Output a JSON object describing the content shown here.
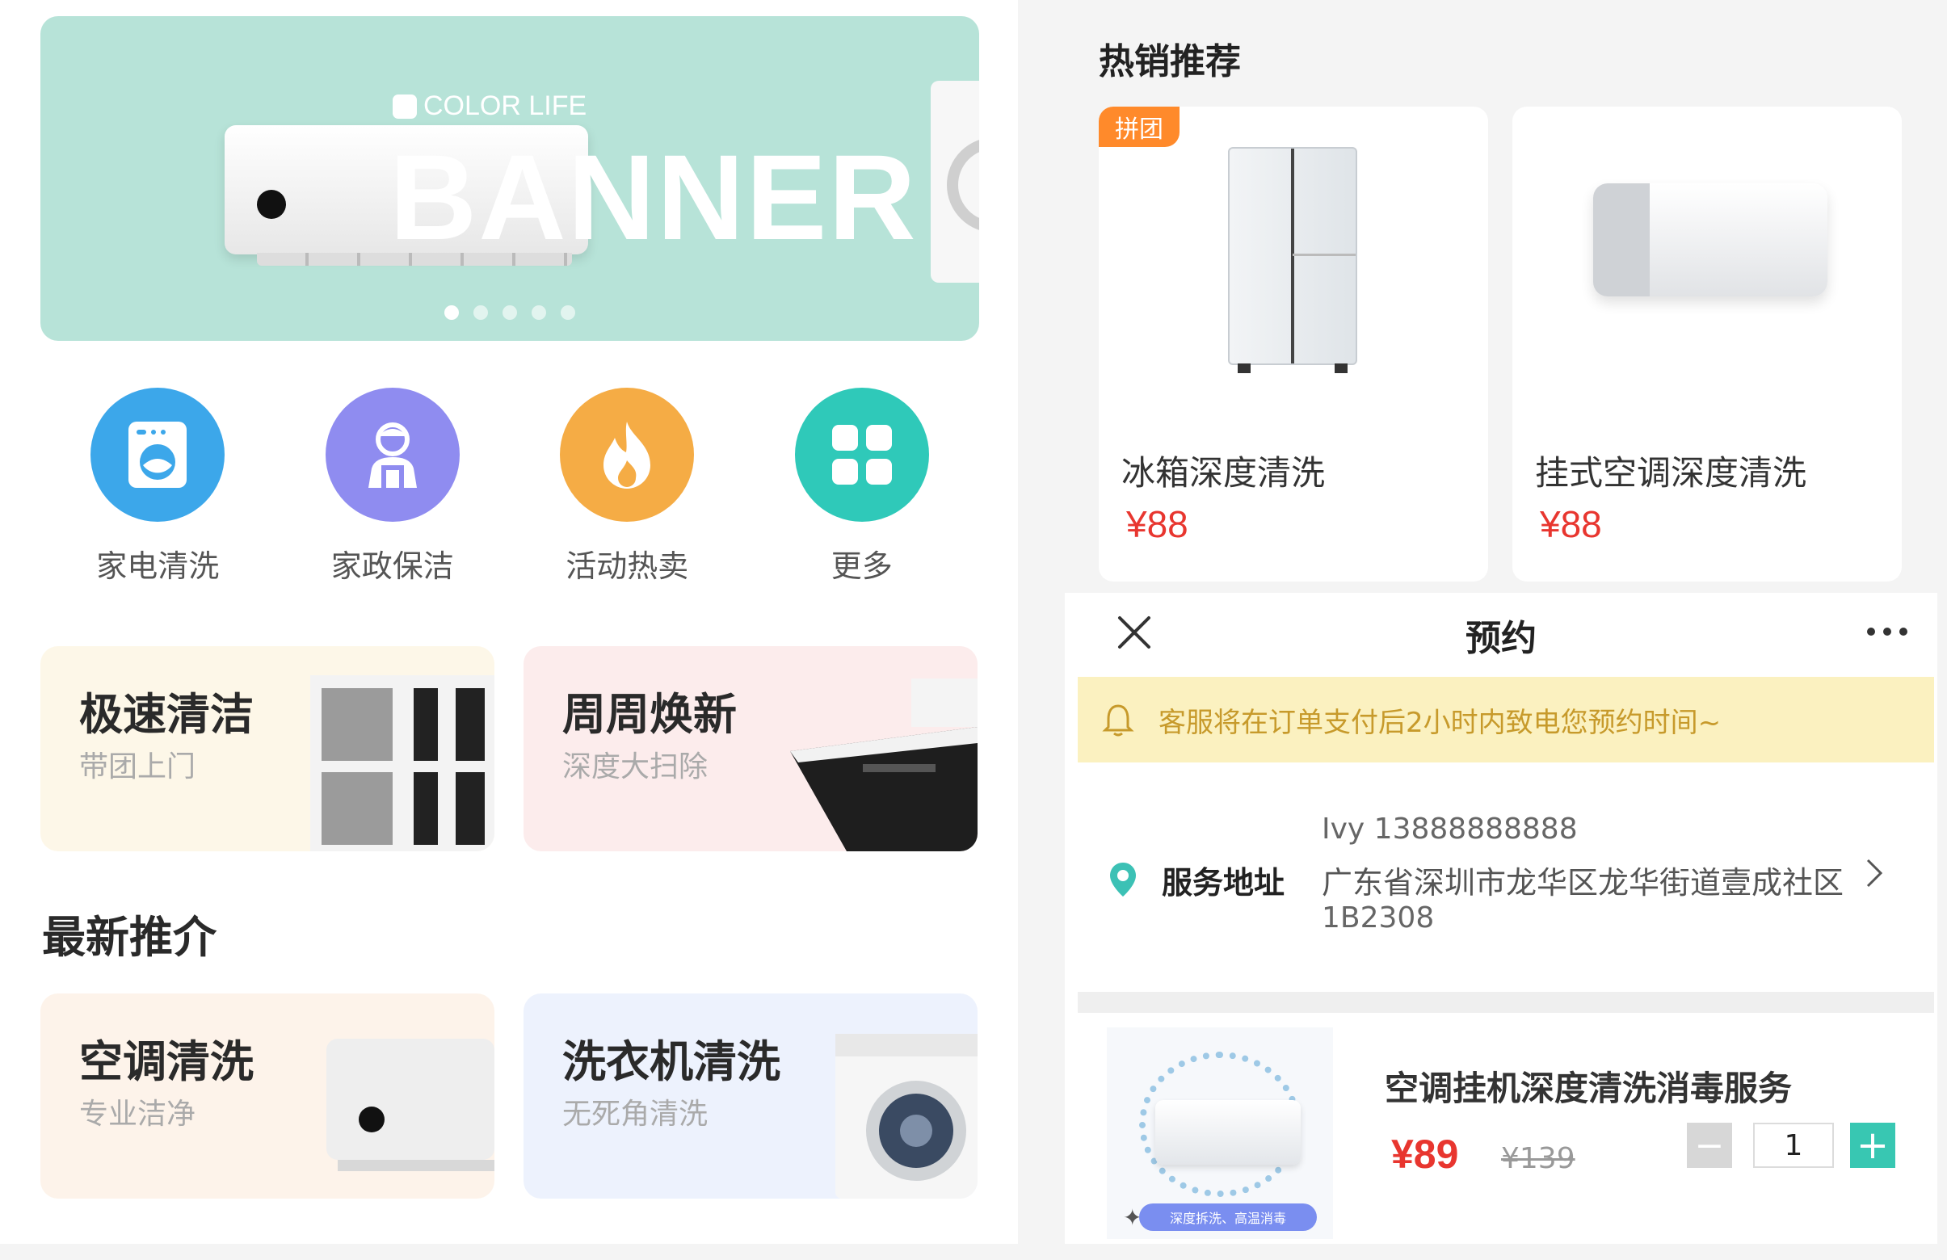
{
  "home": {
    "banner": {
      "brand": "COLOR LIFE",
      "headline": "BANNER",
      "slide_count": 5,
      "active_slide": 1
    },
    "categories": [
      {
        "label": "家电清洗",
        "icon": "washing-machine-icon",
        "color": "#3ca7ea"
      },
      {
        "label": "家政保洁",
        "icon": "housekeeper-icon",
        "color": "#8f8cf0"
      },
      {
        "label": "活动热卖",
        "icon": "flame-icon",
        "color": "#f5ac45"
      },
      {
        "label": "更多",
        "icon": "grid-icon",
        "color": "#2fc9b9"
      }
    ],
    "promo_cards": [
      {
        "title": "极速清洁",
        "subtitle": "带团上门"
      },
      {
        "title": "周周焕新",
        "subtitle": "深度大扫除"
      }
    ],
    "section_title": "最新推介",
    "latest_cards": [
      {
        "title": "空调清洗",
        "subtitle": "专业洁净"
      },
      {
        "title": "洗衣机清洗",
        "subtitle": "无死角清洗"
      }
    ]
  },
  "hot": {
    "title": "热销推荐",
    "products": [
      {
        "tag": "拼团",
        "name": "冰箱深度清洗",
        "price": "¥88"
      },
      {
        "tag": "",
        "name": "挂式空调深度清洗",
        "price": "¥88"
      }
    ]
  },
  "booking": {
    "title": "预约",
    "close_icon": "close-icon",
    "more_icon": "more-icon",
    "notice": "客服将在订单支付后2小时内致电您预约时间~",
    "address": {
      "label": "服务地址",
      "contact": "Ivy   13888888888",
      "line": "广东省深圳市龙华区龙华街道壹成社区",
      "line2": "1B2308"
    },
    "order": {
      "name": "空调挂机深度清洗消毒服务",
      "price": "¥89",
      "old_price": "¥139",
      "quantity": "1",
      "thumb_pill": "深度拆洗、高温消毒"
    }
  },
  "colors": {
    "banner_bg": "#b7e3d8",
    "price_red": "#e8362f",
    "notice_bg": "#fbf1c0",
    "notice_text": "#c79a2b",
    "plus_green": "#38c7b2",
    "group_tag": "#ff8a2b"
  }
}
